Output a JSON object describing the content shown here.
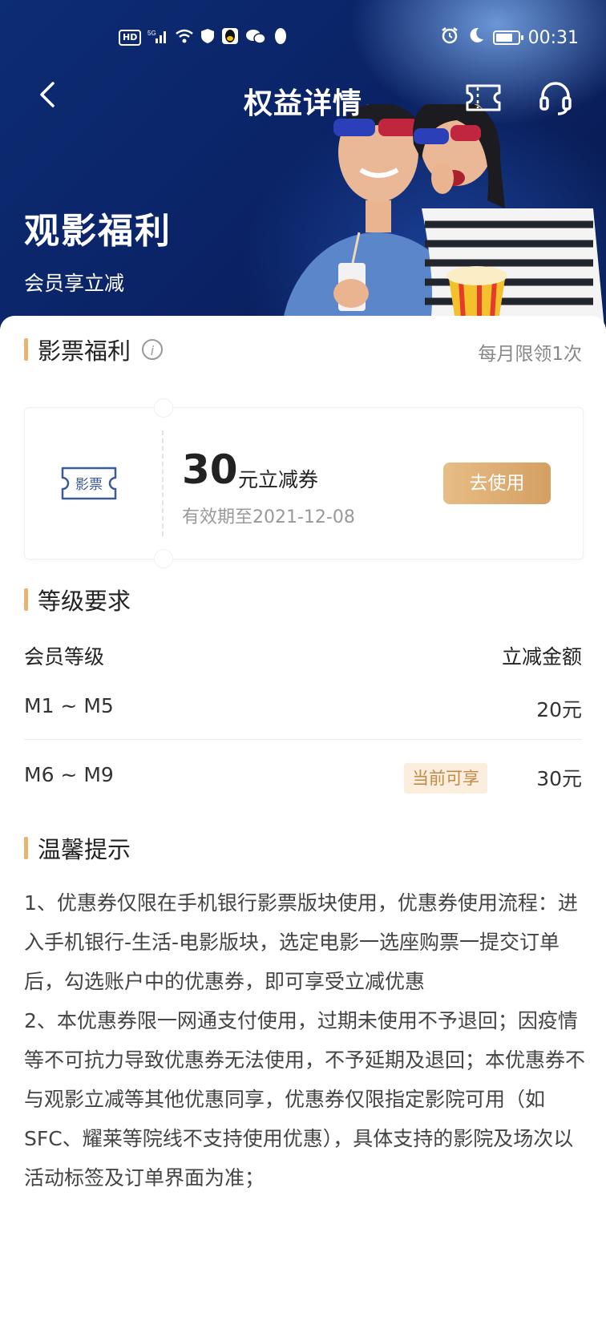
{
  "status_bar": {
    "left_items": [
      "HD",
      "5G",
      "signal",
      "wifi",
      "shield",
      "qq",
      "wechat",
      "penguin"
    ],
    "time": "00:31"
  },
  "nav": {
    "title": "权益详情",
    "back_icon": "chevron-left-icon",
    "ticket_icon": "ticket-icon",
    "service_icon": "headset-icon"
  },
  "hero": {
    "title": "观影福利",
    "subtitle": "会员享立减"
  },
  "ticket_section": {
    "title": "影票福利",
    "limit": "每月限领1次",
    "coupon": {
      "icon_label": "影票",
      "amount": "30",
      "unit": "元立减券",
      "expiry": "有效期至2021-12-08",
      "button": "去使用"
    }
  },
  "level_section": {
    "title": "等级要求",
    "headers": {
      "level": "会员等级",
      "discount": "立减金额"
    },
    "rows": [
      {
        "level": "M1 ~ M5",
        "discount": "20元",
        "badge": ""
      },
      {
        "level": "M6 ~ M9",
        "discount": "30元",
        "badge": "当前可享"
      }
    ]
  },
  "tips_section": {
    "title": "温馨提示",
    "paragraphs": [
      "1、优惠券仅限在手机银行影票版块使用，优惠券使用流程：进入手机银行-生活-电影版块，选定电影一选座购票一提交订单后，勾选账户中的优惠券，即可享受立减优惠",
      "2、本优惠券限一网通支付使用，过期未使用不予退回；因疫情等不可抗力导致优惠券无法使用，不予延期及退回；本优惠券不与观影立减等其他优惠同享，优惠券仅限指定影院可用（如SFC、耀莱等院线不支持使用优惠），具体支持的影院及场次以活动标签及订单界面为准；"
    ]
  },
  "colors": {
    "accent": "#e7b36f",
    "button_start": "#e7bd86",
    "button_end": "#d59f62",
    "badge_bg": "#fbeedc",
    "badge_text": "#c08a4a",
    "hero_bg": "#0b2468"
  }
}
